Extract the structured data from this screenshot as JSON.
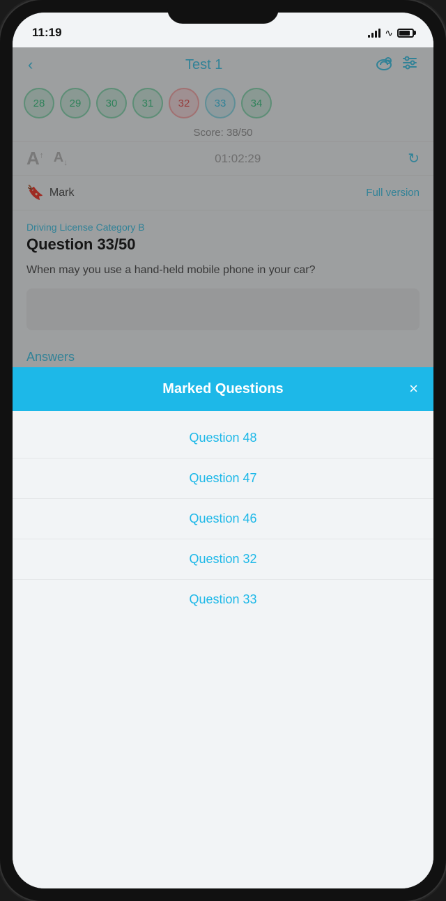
{
  "statusBar": {
    "time": "11:19",
    "batteryIcon": "battery"
  },
  "header": {
    "backLabel": "‹",
    "title": "Test 1",
    "cloudIcon": "☁",
    "settingsIcon": "⚙"
  },
  "questionNav": {
    "bubbles": [
      {
        "number": "28",
        "state": "green"
      },
      {
        "number": "29",
        "state": "green"
      },
      {
        "number": "30",
        "state": "green"
      },
      {
        "number": "31",
        "state": "green"
      },
      {
        "number": "32",
        "state": "red"
      },
      {
        "number": "33",
        "state": "current"
      },
      {
        "number": "34",
        "state": "green"
      }
    ]
  },
  "score": {
    "label": "Score: 38/50"
  },
  "fontControls": {
    "fontLarge": "A",
    "fontSmall": "A",
    "timer": "01:02:29"
  },
  "markRow": {
    "bookmarkLabel": "Mark",
    "fullVersionLabel": "Full version"
  },
  "question": {
    "category": "Driving License Category B",
    "number": "Question 33/50",
    "text": "When may you use a hand-held mobile phone in your car?"
  },
  "answersLabel": "Answers",
  "modal": {
    "title": "Marked Questions",
    "closeLabel": "×",
    "items": [
      {
        "label": "Question 48"
      },
      {
        "label": "Question 47"
      },
      {
        "label": "Question 46"
      },
      {
        "label": "Question 32"
      },
      {
        "label": "Question 33"
      }
    ]
  }
}
